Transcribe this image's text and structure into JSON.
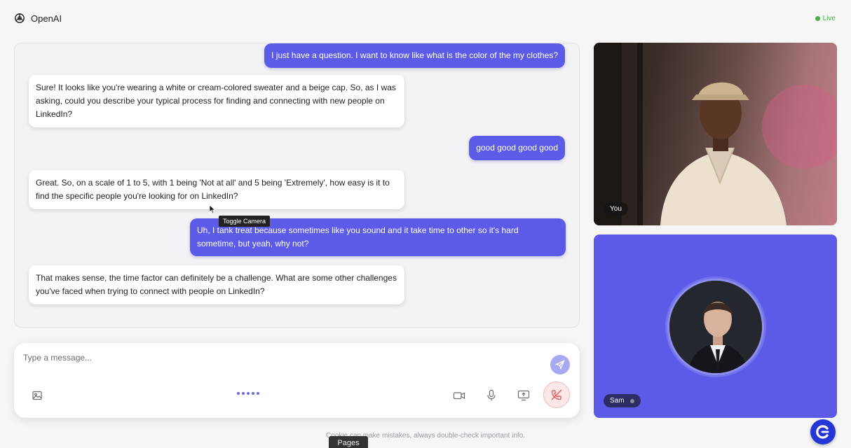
{
  "app": {
    "title": "OpenAI",
    "status": "Live",
    "status_color": "#43b04a"
  },
  "chat": {
    "messages": [
      {
        "role": "user",
        "text": "I just have a question. I want to know like what is the color of the my clothes?"
      },
      {
        "role": "bot",
        "text": "Sure! It looks like you're wearing a white or cream-colored sweater and a beige cap. So, as I was asking, could you describe your typical process for finding and connecting with new people on LinkedIn?"
      },
      {
        "role": "user",
        "text": "good good good good"
      },
      {
        "role": "bot",
        "text": "Great. So, on a scale of 1 to 5, with 1 being 'Not at all' and 5 being 'Extremely', how easy is it to find the specific people you're looking for on LinkedIn?"
      },
      {
        "role": "user",
        "text": "Uh, I tank treat because sometimes like you sound and it take time to other so it's hard sometime, but yeah, why not?"
      },
      {
        "role": "bot",
        "text": "That makes sense, the time factor can definitely be a challenge. What are some other challenges you've faced when trying to connect with people on LinkedIn?"
      }
    ],
    "tooltip": "Toggle Camera"
  },
  "composer": {
    "placeholder": "Type a message...",
    "icons": [
      "image-icon",
      "send-icon",
      "camera-icon",
      "microphone-icon",
      "screen-share-icon",
      "hang-up-icon"
    ]
  },
  "video": {
    "you_label": "You",
    "agent_label": "Sam"
  },
  "footer": {
    "note": "Cookie can make mistakes, always double-check important info.",
    "pages_tab": "Pages"
  },
  "colors": {
    "accent": "#5b5be8",
    "send_button": "#a7a9f2",
    "hangup_bg": "#fde8e8",
    "hangup_icon": "#e05555"
  }
}
